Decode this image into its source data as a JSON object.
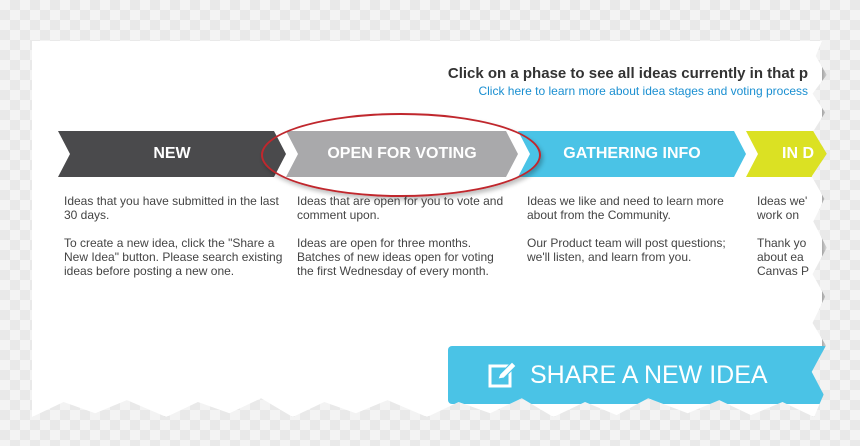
{
  "header": {
    "heading": "Click on a phase to see all ideas currently in that p",
    "learn_link": "Click here to learn more about idea stages and voting process"
  },
  "phases": [
    {
      "label": "NEW",
      "color": "#4a4a4c",
      "desc_1": "Ideas that you have submitted in the last 30 days.",
      "desc_2": "To create a new idea, click the \"Share a New Idea\" button. Please search existing ideas before posting a new one."
    },
    {
      "label": "OPEN FOR VOTING",
      "color": "#a9a9ab",
      "desc_1": "Ideas that are open for you to vote and comment upon.",
      "desc_2": "Ideas are open for three months. Batches of new ideas open for voting the first Wednesday of every month."
    },
    {
      "label": "GATHERING INFO",
      "color": "#4ac3e6",
      "desc_1": "Ideas we like and need to learn more about from the Community.",
      "desc_2": "Our Product team will post questions; we'll listen, and learn from you."
    },
    {
      "label": "IN D",
      "color": "#dbe123",
      "desc_1": "Ideas we'\nwork on",
      "desc_2": "Thank yo\nabout ea\nCanvas P"
    }
  ],
  "share_button": {
    "label": "SHARE A NEW IDEA",
    "icon": "edit-icon",
    "color": "#4ac3e6"
  },
  "highlight_color": "#c0272d"
}
